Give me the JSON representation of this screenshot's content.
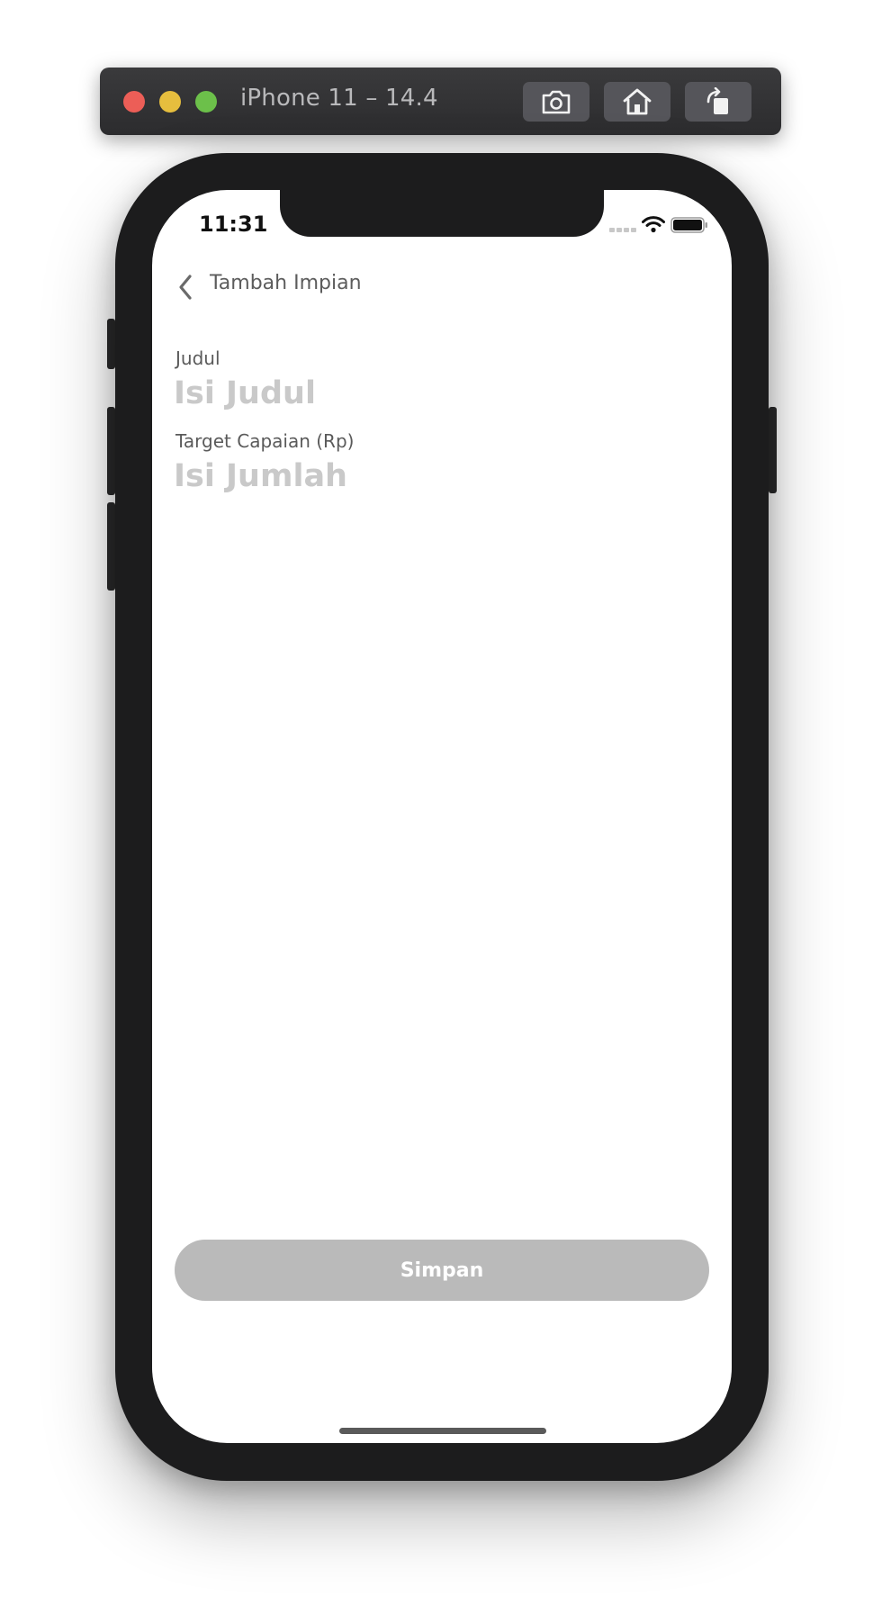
{
  "simulator": {
    "title": "iPhone 11 – 14.4",
    "buttons": [
      {
        "icon": "camera-icon",
        "label": "Screenshot"
      },
      {
        "icon": "home-icon",
        "label": "Home"
      },
      {
        "icon": "rotate-icon",
        "label": "Rotate"
      }
    ]
  },
  "status_bar": {
    "time": "11:31",
    "icons": [
      "cellular-signal-icon",
      "wifi-icon",
      "battery-icon"
    ]
  },
  "nav": {
    "back_icon": "chevron-left-icon",
    "title": "Tambah Impian"
  },
  "form": {
    "judul": {
      "label": "Judul",
      "placeholder": "Isi Judul",
      "value": ""
    },
    "target": {
      "label": "Target Capaian (Rp)",
      "placeholder": "Isi Jumlah",
      "value": ""
    }
  },
  "actions": {
    "save_label": "Simpan",
    "save_disabled": true
  },
  "colors": {
    "button_disabled": "#bababa",
    "placeholder": "#c9c9c9",
    "label": "#5a5a5a",
    "device_frame": "#1c1c1d"
  }
}
